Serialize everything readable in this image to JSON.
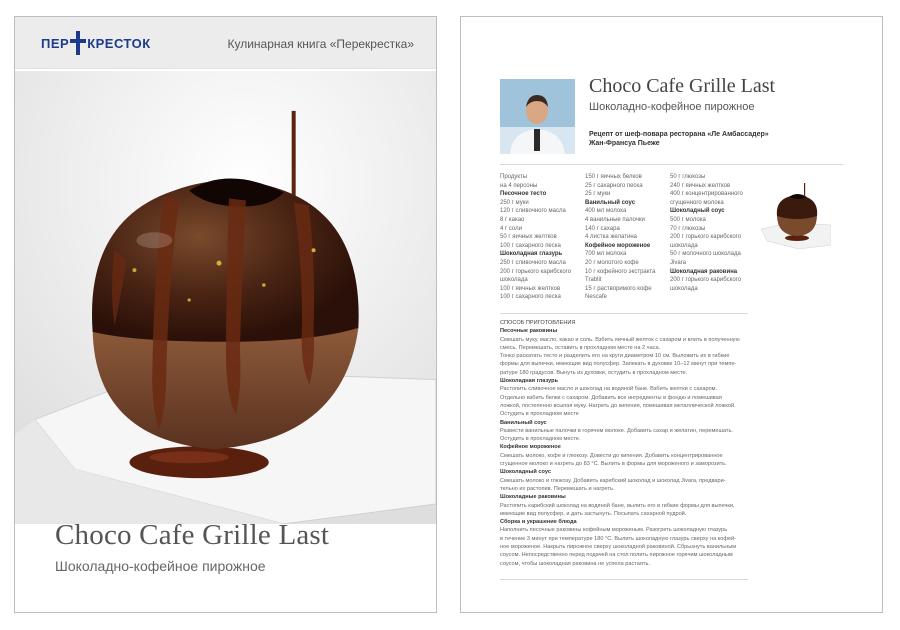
{
  "cover": {
    "logo_text_left": "ПЕР",
    "logo_text_right": "КРЕСТОК",
    "header_title": "Кулинарная книга «Перекрестка»",
    "title": "Choco Cafe Grille Last",
    "subtitle": "Шоколадно-кофейное пирожное"
  },
  "recipe": {
    "title": "Choco Cafe Grille Last",
    "subtitle": "Шоколадно-кофейное пирожное",
    "chef_credit_line1": "Рецепт от шеф-повара ресторана «Ле Амбассадер»",
    "chef_credit_line2": "Жан-Франсуа Пьеже",
    "ingredients_col1": [
      {
        "t": "Продукты",
        "h": false
      },
      {
        "t": "на 4 персоны",
        "h": false
      },
      {
        "t": "Песочное тесто",
        "h": true
      },
      {
        "t": "250 г муки",
        "h": false
      },
      {
        "t": "120 г сливочного масла",
        "h": false
      },
      {
        "t": "8 г какао",
        "h": false
      },
      {
        "t": "4 г соли",
        "h": false
      },
      {
        "t": "50 г яичных желтков",
        "h": false
      },
      {
        "t": "100 г сахарного песка",
        "h": false
      },
      {
        "t": "Шоколадная глазурь",
        "h": true
      },
      {
        "t": "250 г сливочного масла",
        "h": false
      },
      {
        "t": "200 г горького карибского",
        "h": false
      },
      {
        "t": "шоколада",
        "h": false
      },
      {
        "t": "100 г яичных желтков",
        "h": false
      },
      {
        "t": "100 г сахарного песка",
        "h": false
      }
    ],
    "ingredients_col2": [
      {
        "t": "150 г яичных белков",
        "h": false
      },
      {
        "t": "25 г сахарного песка",
        "h": false
      },
      {
        "t": "25 г муки",
        "h": false
      },
      {
        "t": "Ванильный соус",
        "h": true
      },
      {
        "t": "400 мл молока",
        "h": false
      },
      {
        "t": "4 ванильные палочки",
        "h": false
      },
      {
        "t": "140 г сахара",
        "h": false
      },
      {
        "t": "4 листка желатина",
        "h": false
      },
      {
        "t": "Кофейное мороженое",
        "h": true
      },
      {
        "t": "700 мл молока",
        "h": false
      },
      {
        "t": "20 г молотого кофе",
        "h": false
      },
      {
        "t": "10 г кофейного экстракта",
        "h": false
      },
      {
        "t": "Trablit",
        "h": false
      },
      {
        "t": "15 г растворимого кофе",
        "h": false
      },
      {
        "t": "Nescafe",
        "h": false
      }
    ],
    "ingredients_col3": [
      {
        "t": "50 г глюкозы",
        "h": false
      },
      {
        "t": "240 г яичных желтков",
        "h": false
      },
      {
        "t": "400 г концентрированного",
        "h": false
      },
      {
        "t": "сгущенного молока",
        "h": false
      },
      {
        "t": "Шоколадный соус",
        "h": true
      },
      {
        "t": "500 г молока",
        "h": false
      },
      {
        "t": "70 г глюкозы",
        "h": false
      },
      {
        "t": "200 г горького карибского",
        "h": false
      },
      {
        "t": "шоколада",
        "h": false
      },
      {
        "t": "50 г молочного шоколада",
        "h": false
      },
      {
        "t": "Jivara",
        "h": false
      },
      {
        "t": "Шоколадная раковина",
        "h": true
      },
      {
        "t": "200 г горького карибского",
        "h": false
      },
      {
        "t": "шоколада",
        "h": false
      }
    ],
    "method": [
      {
        "t": "СПОСОБ ПРИГОТОВЛЕНИЯ",
        "c": "mh"
      },
      {
        "t": "Песочные раковины",
        "c": "h"
      },
      {
        "t": "Смешать муку, масло, какао и соль. Взбить яичный желток с сахаром и влить в полученную",
        "c": ""
      },
      {
        "t": "смесь. Перемешать, оставить в прохладном месте на 2 часа.",
        "c": ""
      },
      {
        "t": "Тонко раскатать тесто и разделить его на круги диаметром 10 см. Выложить их в гибкие",
        "c": ""
      },
      {
        "t": "формы для выпечки, имеющие вид полусфер. Запекать в духовке 10–12 минут при темпе-",
        "c": ""
      },
      {
        "t": "ратуре 180 градусов. Вынуть из духовки, остудить в прохладном месте.",
        "c": ""
      },
      {
        "t": "Шоколадная глазурь",
        "c": "h"
      },
      {
        "t": "Растопить сливочное масло и шоколад на водяной бане. Взбить желтки с сахаром.",
        "c": ""
      },
      {
        "t": "Отдельно взбить белки с сахаром. Добавить все ингредиенты в фондю и помешивая",
        "c": ""
      },
      {
        "t": "ложкой, постепенно всыпая муку. Нагреть до кипения, помешивая металлической ложкой.",
        "c": ""
      },
      {
        "t": "Остудить в прохладном месте",
        "c": ""
      },
      {
        "t": "Ванильный соус",
        "c": "h"
      },
      {
        "t": "Развести ванильные палочки в горячем молоке. Добавить сахар и желатин, перемешать.",
        "c": ""
      },
      {
        "t": "Остудить в прохладном месте.",
        "c": ""
      },
      {
        "t": "Кофейное мороженое",
        "c": "h"
      },
      {
        "t": "Смешать молоко, кофе и глюкозу. Довести до кипения. Добавить концентрированное",
        "c": ""
      },
      {
        "t": "сгущенное молоко и нагреть до 83 °С. Вылить в формы для мороженого и заморозить.",
        "c": ""
      },
      {
        "t": "Шоколадный соус",
        "c": "h"
      },
      {
        "t": "Смешать молоко и глюкозу. Добавить карибский шоколад и шоколад Jivara, предвари-",
        "c": ""
      },
      {
        "t": "тельно их растопив. Перемешать и нагреть.",
        "c": ""
      },
      {
        "t": "Шоколадные раковины",
        "c": "h"
      },
      {
        "t": "Растопить карибский шоколад на водяной бане, вылить его в гибкие формы для выпечки,",
        "c": ""
      },
      {
        "t": "имеющие вид полусфер, и дать застынуть. Посыпать сахарной пудрой.",
        "c": ""
      },
      {
        "t": "Сборка и украшение блюда",
        "c": "h"
      },
      {
        "t": "Наполнить песочные раковины кофейным мороженым. Разогреть шоколадную глазурь",
        "c": ""
      },
      {
        "t": "в течение 3 минут при температуре 180 °С. Вылить шоколадную глазурь сверху на кофей-",
        "c": ""
      },
      {
        "t": "ное мороженое. Накрыть пирожное сверху шоколадной раковиной. Сбрызнуть ванильным",
        "c": ""
      },
      {
        "t": "соусом. Непосредственно перед подачей на стол полить пирожное горячим шоколадным",
        "c": ""
      },
      {
        "t": "соусом, чтобы шоколадная раковина не успела растаять.",
        "c": ""
      }
    ]
  }
}
